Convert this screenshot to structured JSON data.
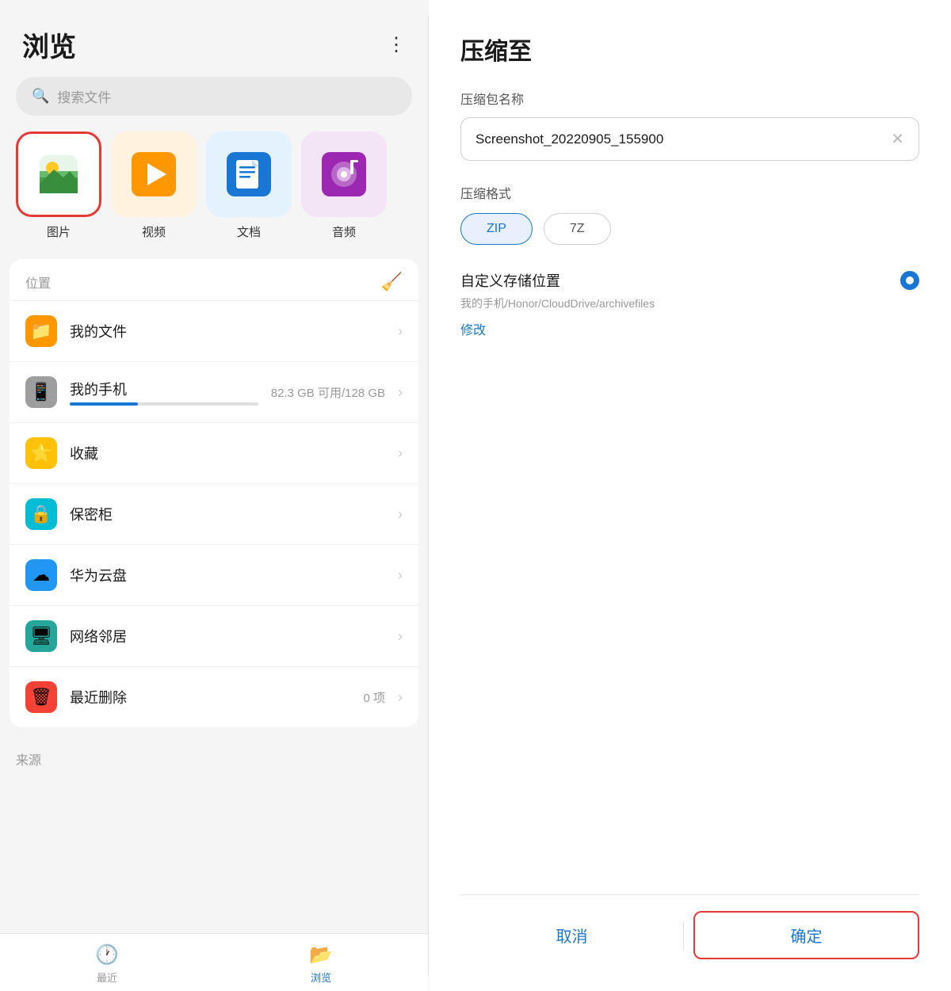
{
  "left": {
    "title": "浏览",
    "more_icon": "⋮",
    "search_placeholder": "搜索文件",
    "categories": [
      {
        "id": "photos",
        "label": "图片",
        "emoji": "🖼",
        "selected": true
      },
      {
        "id": "videos",
        "label": "视频",
        "emoji": "▶",
        "color": "#ff9800"
      },
      {
        "id": "docs",
        "label": "文档",
        "emoji": "📄",
        "color": "#1976d2"
      },
      {
        "id": "audio",
        "label": "音频",
        "emoji": "🎵",
        "color": "#9c27b0"
      }
    ],
    "location_section": {
      "title": "位置",
      "items": [
        {
          "id": "my-files",
          "icon": "📁",
          "icon_color": "orange",
          "name": "我的文件",
          "meta": "",
          "has_chevron": true
        },
        {
          "id": "my-phone",
          "icon": "📱",
          "icon_color": "gray",
          "name": "我的手机",
          "meta": "82.3 GB 可用/128 GB",
          "has_chevron": true,
          "has_bar": true
        },
        {
          "id": "favorites",
          "icon": "⭐",
          "icon_color": "yellow",
          "name": "收藏",
          "meta": "",
          "has_chevron": true
        },
        {
          "id": "safe",
          "icon": "🔒",
          "icon_color": "blue-green",
          "name": "保密柜",
          "meta": "",
          "has_chevron": true
        },
        {
          "id": "huawei-cloud",
          "icon": "☁",
          "icon_color": "blue",
          "name": "华为云盘",
          "meta": "",
          "has_chevron": true
        },
        {
          "id": "network",
          "icon": "🖥",
          "icon_color": "teal",
          "name": "网络邻居",
          "meta": "",
          "has_chevron": true
        },
        {
          "id": "trash",
          "icon": "🗑",
          "icon_color": "red",
          "name": "最近删除",
          "meta": "0 项",
          "has_chevron": true
        }
      ]
    },
    "source_section": {
      "title": "来源"
    },
    "nav": [
      {
        "id": "recent",
        "label": "最近",
        "icon": "🕐",
        "active": false
      },
      {
        "id": "browse",
        "label": "浏览",
        "icon": "📂",
        "active": true
      }
    ]
  },
  "right": {
    "title": "压缩至",
    "name_label": "压缩包名称",
    "name_value": "Screenshot_20220905_155900",
    "format_label": "压缩格式",
    "formats": [
      {
        "id": "zip",
        "label": "ZIP",
        "selected": true
      },
      {
        "id": "7z",
        "label": "7Z",
        "selected": false
      }
    ],
    "storage_title": "自定义存储位置",
    "storage_path": "我的手机/Honor/CloudDrive/archivefiles",
    "modify_label": "修改",
    "cancel_label": "取消",
    "confirm_label": "确定"
  }
}
